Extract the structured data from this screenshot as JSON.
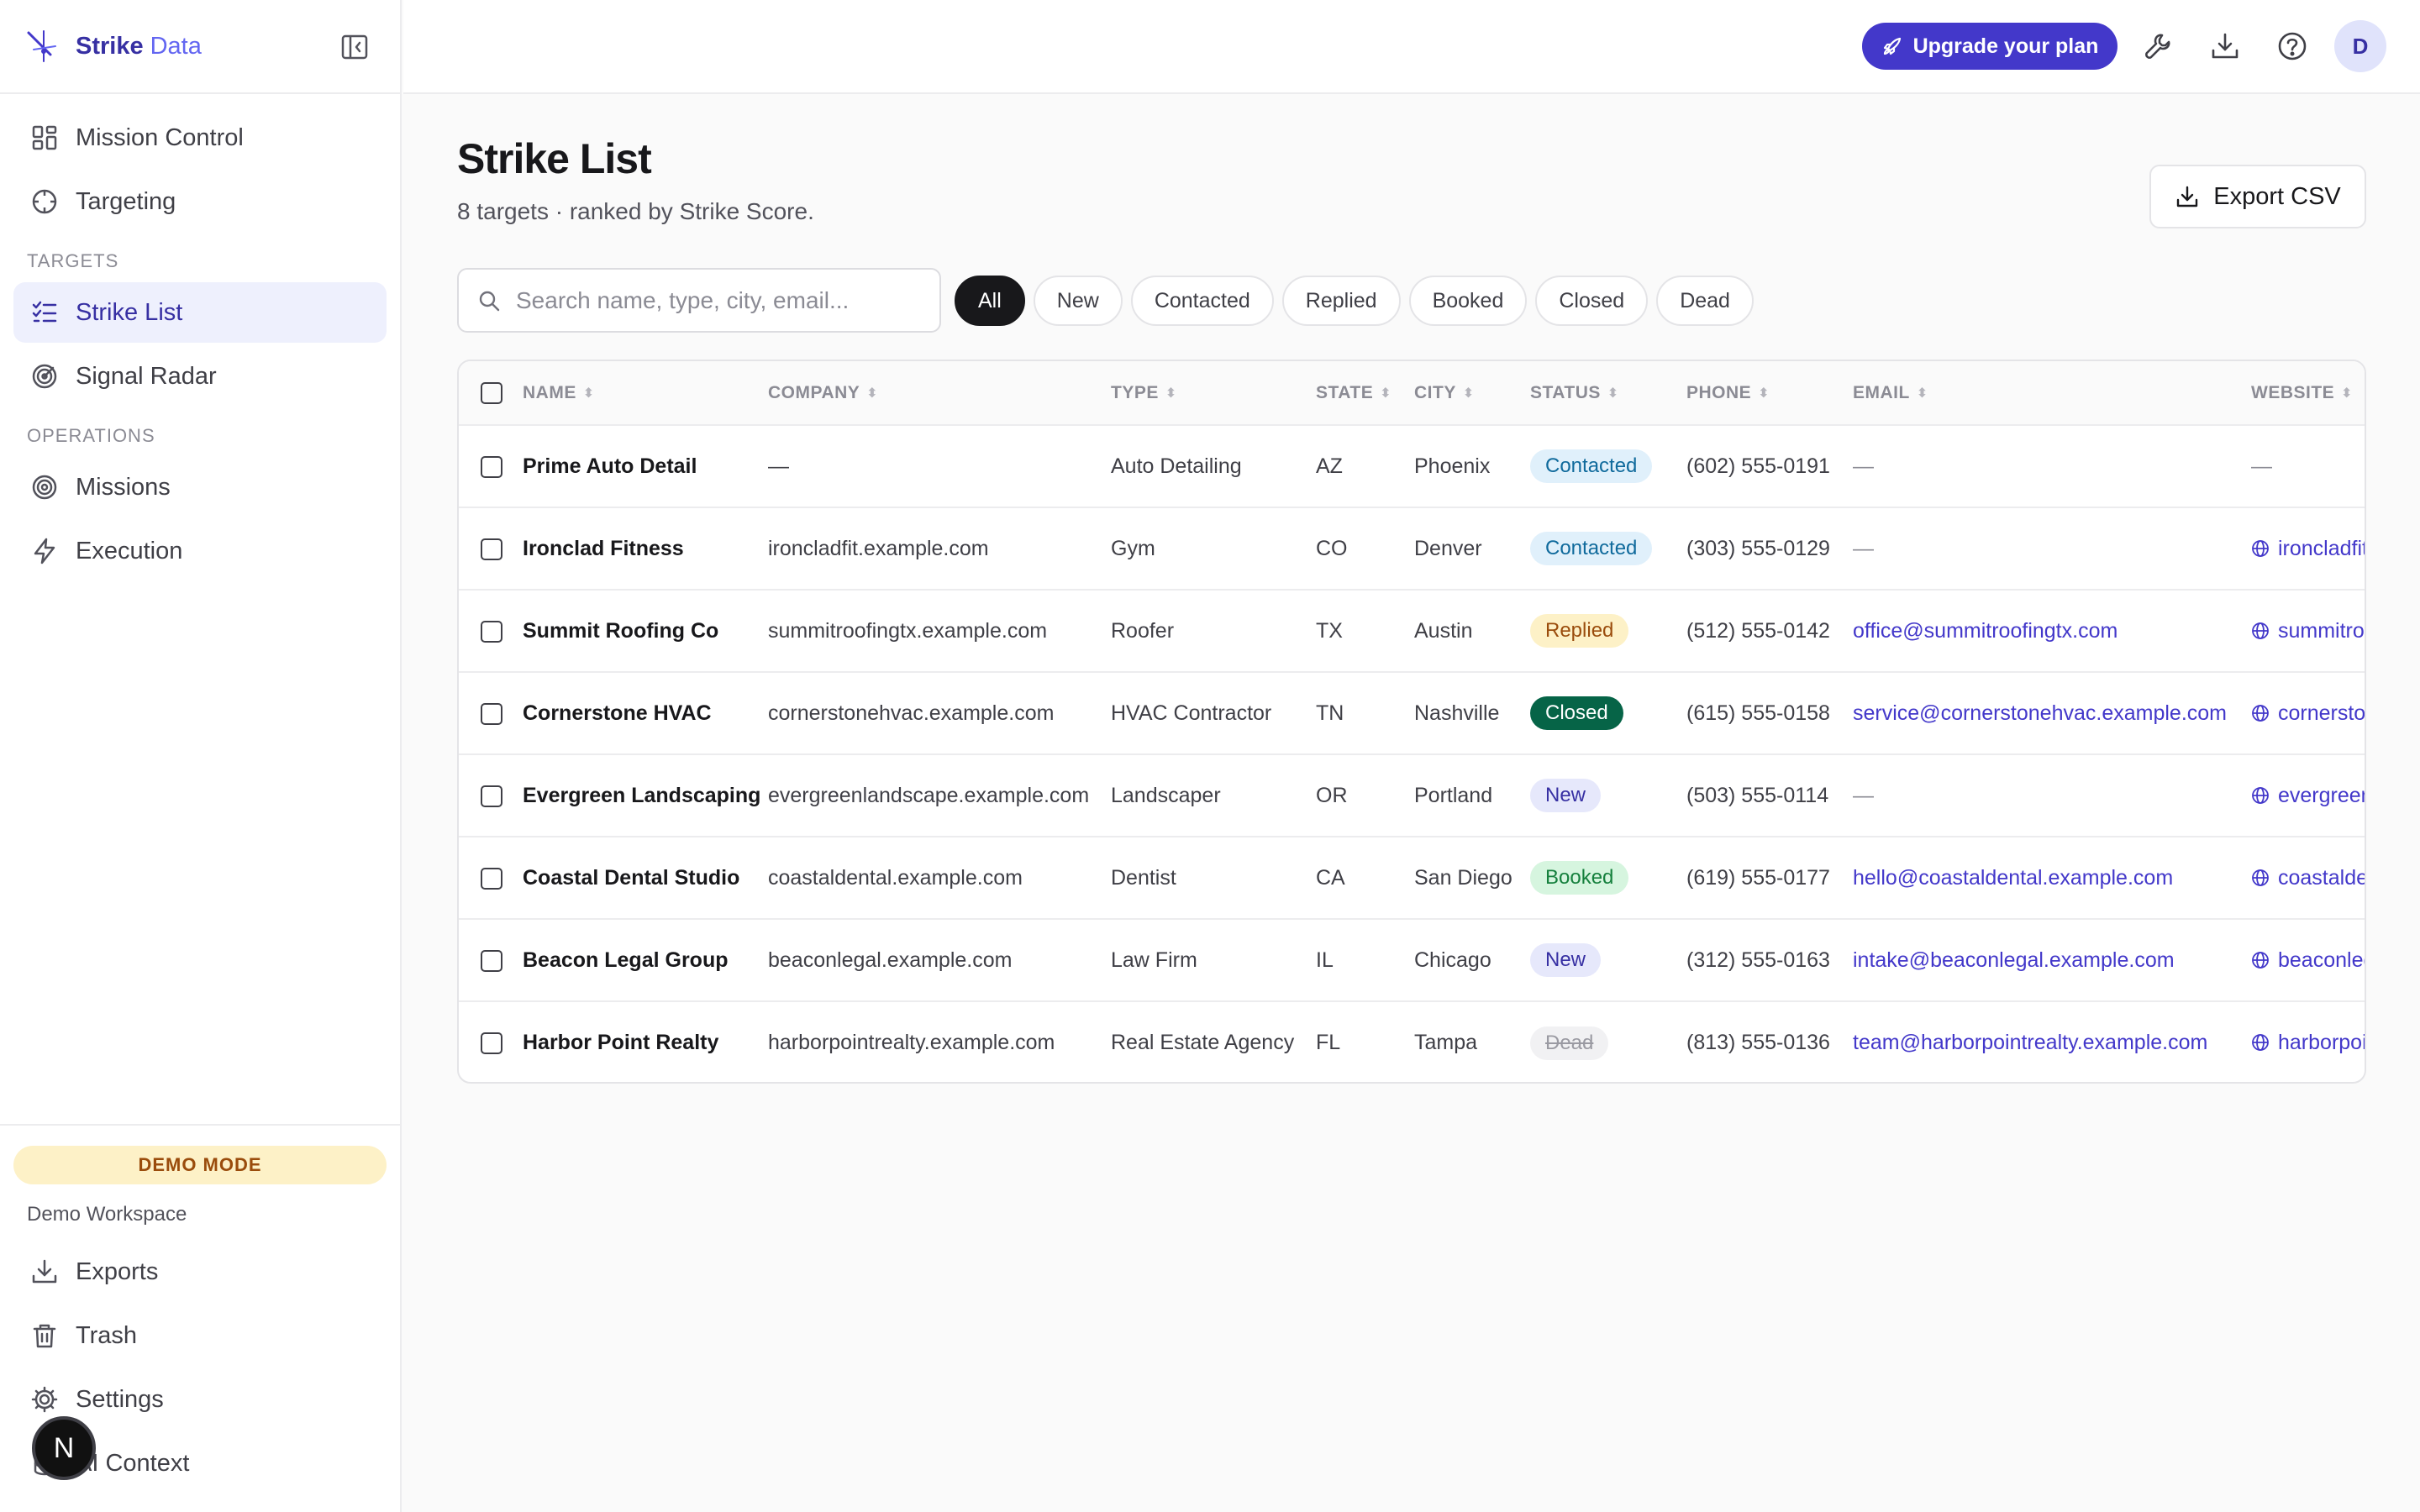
{
  "brand": {
    "name": "Strike",
    "sub": "Data"
  },
  "nav": {
    "top": [
      {
        "label": "Mission Control",
        "icon": "grid-icon"
      },
      {
        "label": "Targeting",
        "icon": "crosshair-icon"
      }
    ],
    "targets_header": "TARGETS",
    "targets": [
      {
        "label": "Strike List",
        "icon": "list-check-icon",
        "active": true
      },
      {
        "label": "Signal Radar",
        "icon": "radar-icon"
      }
    ],
    "operations_header": "OPERATIONS",
    "operations": [
      {
        "label": "Missions",
        "icon": "target-icon"
      },
      {
        "label": "Execution",
        "icon": "bolt-icon"
      }
    ],
    "demo_mode": "DEMO MODE",
    "workspace": "Demo Workspace",
    "bottom": [
      {
        "label": "Exports",
        "icon": "download-icon"
      },
      {
        "label": "Trash",
        "icon": "trash-icon"
      },
      {
        "label": "Settings",
        "icon": "gear-icon"
      },
      {
        "label": "AI Context",
        "icon": "database-icon"
      }
    ],
    "floating_avatar": "N"
  },
  "topbar": {
    "upgrade_label": "Upgrade your plan",
    "user_initial": "D"
  },
  "page": {
    "title": "Strike List",
    "subtitle": "8 targets · ranked by Strike Score.",
    "export_label": "Export CSV"
  },
  "search": {
    "placeholder": "Search name, type, city, email..."
  },
  "filters": [
    "All",
    "New",
    "Contacted",
    "Replied",
    "Booked",
    "Closed",
    "Dead"
  ],
  "active_filter": "All",
  "table": {
    "columns": [
      "NAME",
      "COMPANY",
      "TYPE",
      "STATE",
      "CITY",
      "STATUS",
      "PHONE",
      "EMAIL",
      "WEBSITE"
    ],
    "rows": [
      {
        "name": "Prime Auto Detail",
        "company": "—",
        "type": "Auto Detailing",
        "state": "AZ",
        "city": "Phoenix",
        "status": "Contacted",
        "phone": "(602) 555-0191",
        "email": "—",
        "website": "—"
      },
      {
        "name": "Ironclad Fitness",
        "company": "ironcladfit.example.com",
        "type": "Gym",
        "state": "CO",
        "city": "Denver",
        "status": "Contacted",
        "phone": "(303) 555-0129",
        "email": "—",
        "website": "ironcladfit.example.com"
      },
      {
        "name": "Summit Roofing Co",
        "company": "summitroofingtx.example.com",
        "type": "Roofer",
        "state": "TX",
        "city": "Austin",
        "status": "Replied",
        "phone": "(512) 555-0142",
        "email": "office@summitroofingtx.com",
        "website": "summitroofingtx.example.com"
      },
      {
        "name": "Cornerstone HVAC",
        "company": "cornerstonehvac.example.com",
        "type": "HVAC Contractor",
        "state": "TN",
        "city": "Nashville",
        "status": "Closed",
        "phone": "(615) 555-0158",
        "email": "service@cornerstonehvac.example.com",
        "website": "cornerstonehvac.example.com"
      },
      {
        "name": "Evergreen Landscaping",
        "company": "evergreenlandscape.example.com",
        "type": "Landscaper",
        "state": "OR",
        "city": "Portland",
        "status": "New",
        "phone": "(503) 555-0114",
        "email": "—",
        "website": "evergreenlandscape.example.com"
      },
      {
        "name": "Coastal Dental Studio",
        "company": "coastaldental.example.com",
        "type": "Dentist",
        "state": "CA",
        "city": "San Diego",
        "status": "Booked",
        "phone": "(619) 555-0177",
        "email": "hello@coastaldental.example.com",
        "website": "coastaldental.example.com"
      },
      {
        "name": "Beacon Legal Group",
        "company": "beaconlegal.example.com",
        "type": "Law Firm",
        "state": "IL",
        "city": "Chicago",
        "status": "New",
        "phone": "(312) 555-0163",
        "email": "intake@beaconlegal.example.com",
        "website": "beaconlegal.example.com"
      },
      {
        "name": "Harbor Point Realty",
        "company": "harborpointrealty.example.com",
        "type": "Real Estate Agency",
        "state": "FL",
        "city": "Tampa",
        "status": "Dead",
        "phone": "(813) 555-0136",
        "email": "team@harborpointrealty.example.com",
        "website": "harborpointrealty.example.com"
      }
    ]
  },
  "colors": {
    "accent": "#4338ca",
    "active_nav_bg": "#eef0fd",
    "demo_badge_bg": "#fdf1c7"
  }
}
